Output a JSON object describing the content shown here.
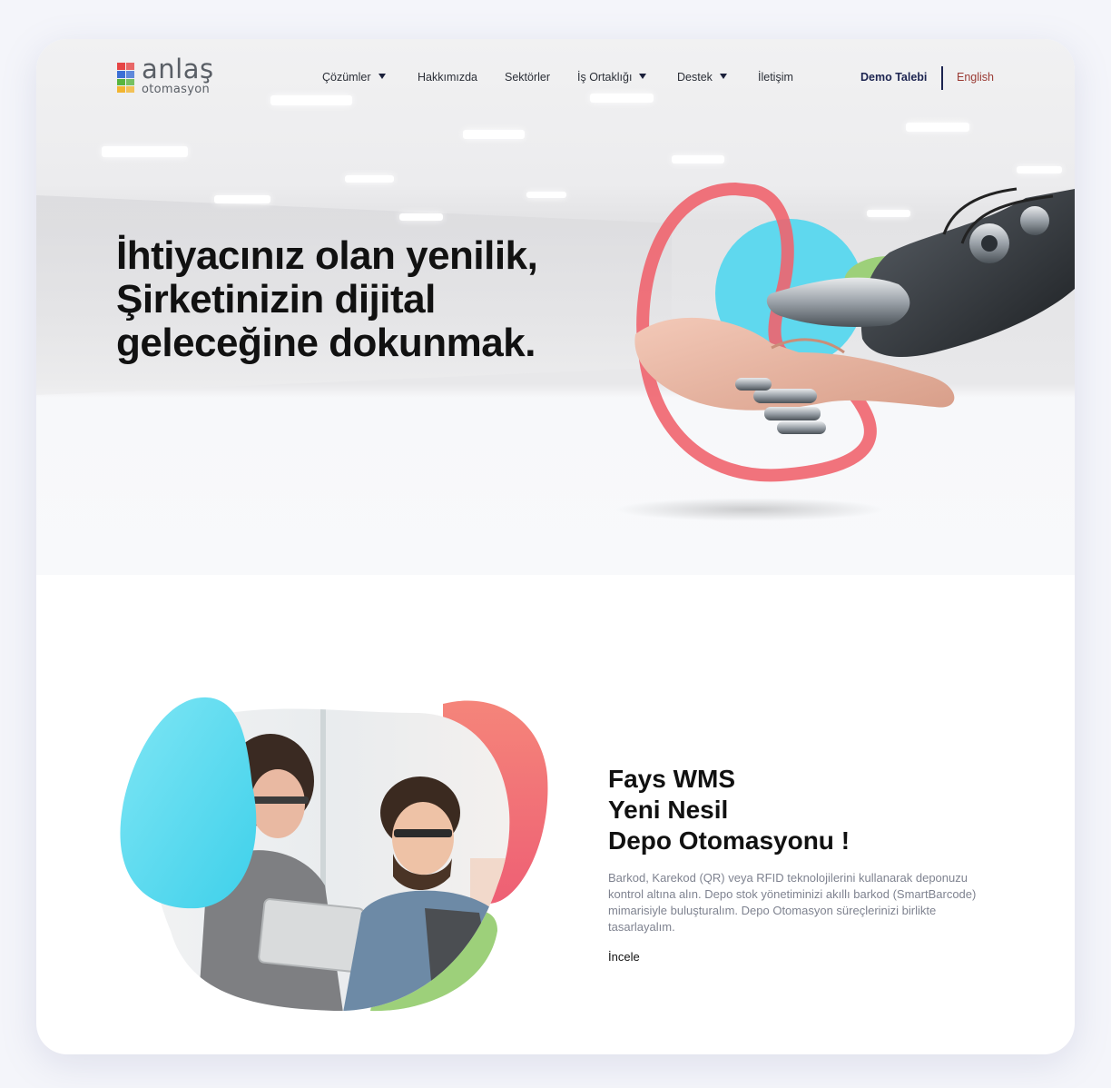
{
  "brand": {
    "name": "anlaş",
    "tagline": "otomasyon"
  },
  "nav": {
    "items": [
      {
        "label": "Çözümler",
        "has_dropdown": true
      },
      {
        "label": "Hakkımızda",
        "has_dropdown": false
      },
      {
        "label": "Sektörler",
        "has_dropdown": false
      },
      {
        "label": "İş Ortaklığı",
        "has_dropdown": true
      },
      {
        "label": "Destek",
        "has_dropdown": true
      },
      {
        "label": "İletişim",
        "has_dropdown": false
      }
    ],
    "demo_label": "Demo Talebi",
    "language_label": "English"
  },
  "hero": {
    "headline_lines": [
      "İhtiyacınız olan yenilik,",
      "Şirketinizin dijital",
      "geleceğine dokunmak."
    ],
    "image_icon": "human-robot-handshake-icon"
  },
  "feature": {
    "title_lines": [
      "Fays WMS",
      "Yeni Nesil",
      "Depo Otomasyonu !"
    ],
    "description": "Barkod, Karekod (QR) veya RFID teknolojilerini kullanarak deponuzu kontrol altına alın. Depo stok yönetiminizi akıllı barkod (SmartBarcode) mimarisiyle buluşturalım. Depo Otomasyon süreçlerinizi birlikte tasarlayalım.",
    "link_label": "İncele",
    "image_icon": "team-with-tablet-photo"
  },
  "colors": {
    "accent_red": "#f0646e",
    "accent_cyan": "#5fd8ee",
    "accent_green": "#9dd07a",
    "nav_dark": "#1c2450",
    "english_link": "#9a3a33"
  }
}
